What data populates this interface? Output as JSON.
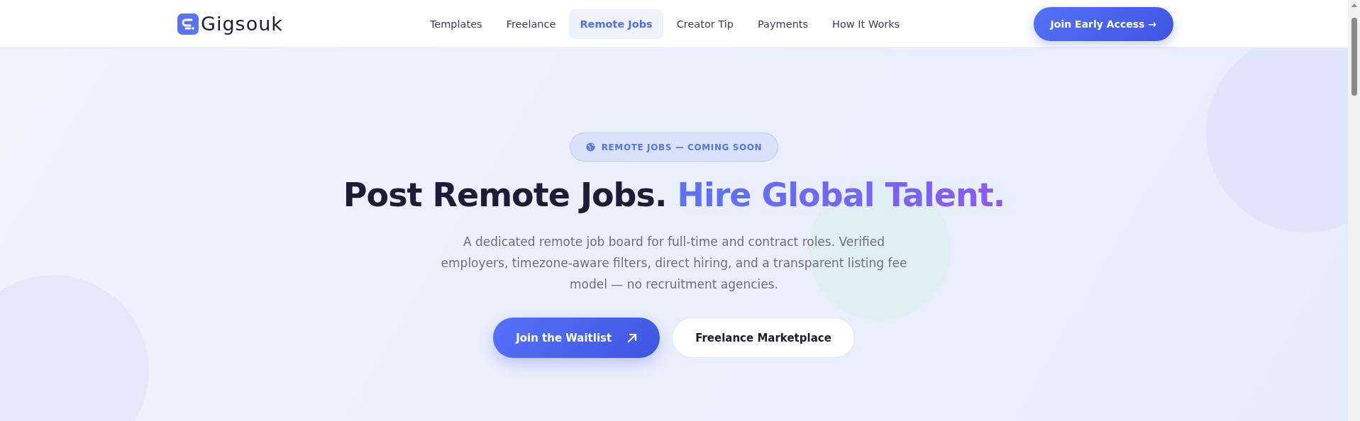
{
  "header": {
    "logo": "Gigsouk",
    "nav": [
      {
        "label": "Templates",
        "selected": false
      },
      {
        "label": "Freelance",
        "selected": false
      },
      {
        "label": "Remote Jobs",
        "selected": true
      },
      {
        "label": "Creator Tip",
        "selected": false
      },
      {
        "label": "Payments",
        "selected": false
      },
      {
        "label": "How It Works",
        "selected": false
      }
    ],
    "cta": "Join Early Access →"
  },
  "hero": {
    "badge": "REMOTE JOBS — COMING SOON",
    "title_lead": "Post Remote Jobs.",
    "title_accent": "Hire Global Talent.",
    "description": "A dedicated remote job board for full-time and contract roles. Verified employers, timezone-aware filters, direct hiring, and a transparent listing fee model — no recruitment agencies.",
    "buttons": [
      {
        "label": "Join the Waitlist",
        "kind": "primary"
      },
      {
        "label": "Freelance Marketplace",
        "kind": "secondary"
      }
    ]
  }
}
